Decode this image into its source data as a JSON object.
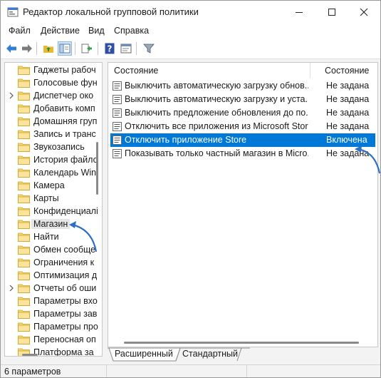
{
  "window": {
    "title": "Редактор локальной групповой политики"
  },
  "menu": {
    "items": [
      {
        "label": "Файл"
      },
      {
        "label": "Действие"
      },
      {
        "label": "Вид"
      },
      {
        "label": "Справка"
      }
    ]
  },
  "toolbar": {
    "buttons": [
      "back-icon",
      "forward-icon",
      "up-folder-icon",
      "show-tree-icon",
      "export-list-icon",
      "help-icon",
      "properties-icon",
      "filter-icon"
    ]
  },
  "tree": {
    "items": [
      {
        "label": "Гаджеты рабоч",
        "expandable": false
      },
      {
        "label": "Голосовые фун",
        "expandable": false
      },
      {
        "label": "Диспетчер око",
        "expandable": true
      },
      {
        "label": "Добавить комп",
        "expandable": false
      },
      {
        "label": "Домашняя груп",
        "expandable": false
      },
      {
        "label": "Запись и транс",
        "expandable": false
      },
      {
        "label": "Звукозапись",
        "expandable": false
      },
      {
        "label": "История файло",
        "expandable": false
      },
      {
        "label": "Календарь Win",
        "expandable": false
      },
      {
        "label": "Камера",
        "expandable": false
      },
      {
        "label": "Карты",
        "expandable": false
      },
      {
        "label": "Конфиденциалі",
        "expandable": false
      },
      {
        "label": "Магазин",
        "expandable": false,
        "selected": true
      },
      {
        "label": "Найти",
        "expandable": false
      },
      {
        "label": "Обмен сообще",
        "expandable": false
      },
      {
        "label": "Ограничения к",
        "expandable": false
      },
      {
        "label": "Оптимизация д",
        "expandable": false
      },
      {
        "label": "Отчеты об оши",
        "expandable": true
      },
      {
        "label": "Параметры вхо",
        "expandable": false
      },
      {
        "label": "Параметры зав",
        "expandable": false
      },
      {
        "label": "Параметры про",
        "expandable": false
      },
      {
        "label": "Переносная оп",
        "expandable": false
      },
      {
        "label": "Платформа за",
        "expandable": false
      }
    ]
  },
  "list": {
    "headers": {
      "name": "Состояние",
      "state": "Состояние"
    },
    "rows": [
      {
        "name": "Выключить автоматическую загрузку обнов...",
        "state": "Не задана",
        "selected": false
      },
      {
        "name": "Выключить автоматическую загрузку и уста...",
        "state": "Не задана",
        "selected": false
      },
      {
        "name": "Выключить предложение обновления до по...",
        "state": "Не задана",
        "selected": false
      },
      {
        "name": "Отключить все приложения из Microsoft Store",
        "state": "Не задана",
        "selected": false
      },
      {
        "name": "Отключить приложение Store",
        "state": "Включена",
        "selected": true
      },
      {
        "name": "Показывать только частный магазин в Micro...",
        "state": "Не задана",
        "selected": false
      }
    ]
  },
  "tabs": {
    "extended": "Расширенный",
    "standard": "Стандартный"
  },
  "status": {
    "text": "6 параметров"
  },
  "colors": {
    "selection": "#0078d7",
    "folder": "#f2c94c",
    "annotation_arrow": "#2f6fc4"
  }
}
